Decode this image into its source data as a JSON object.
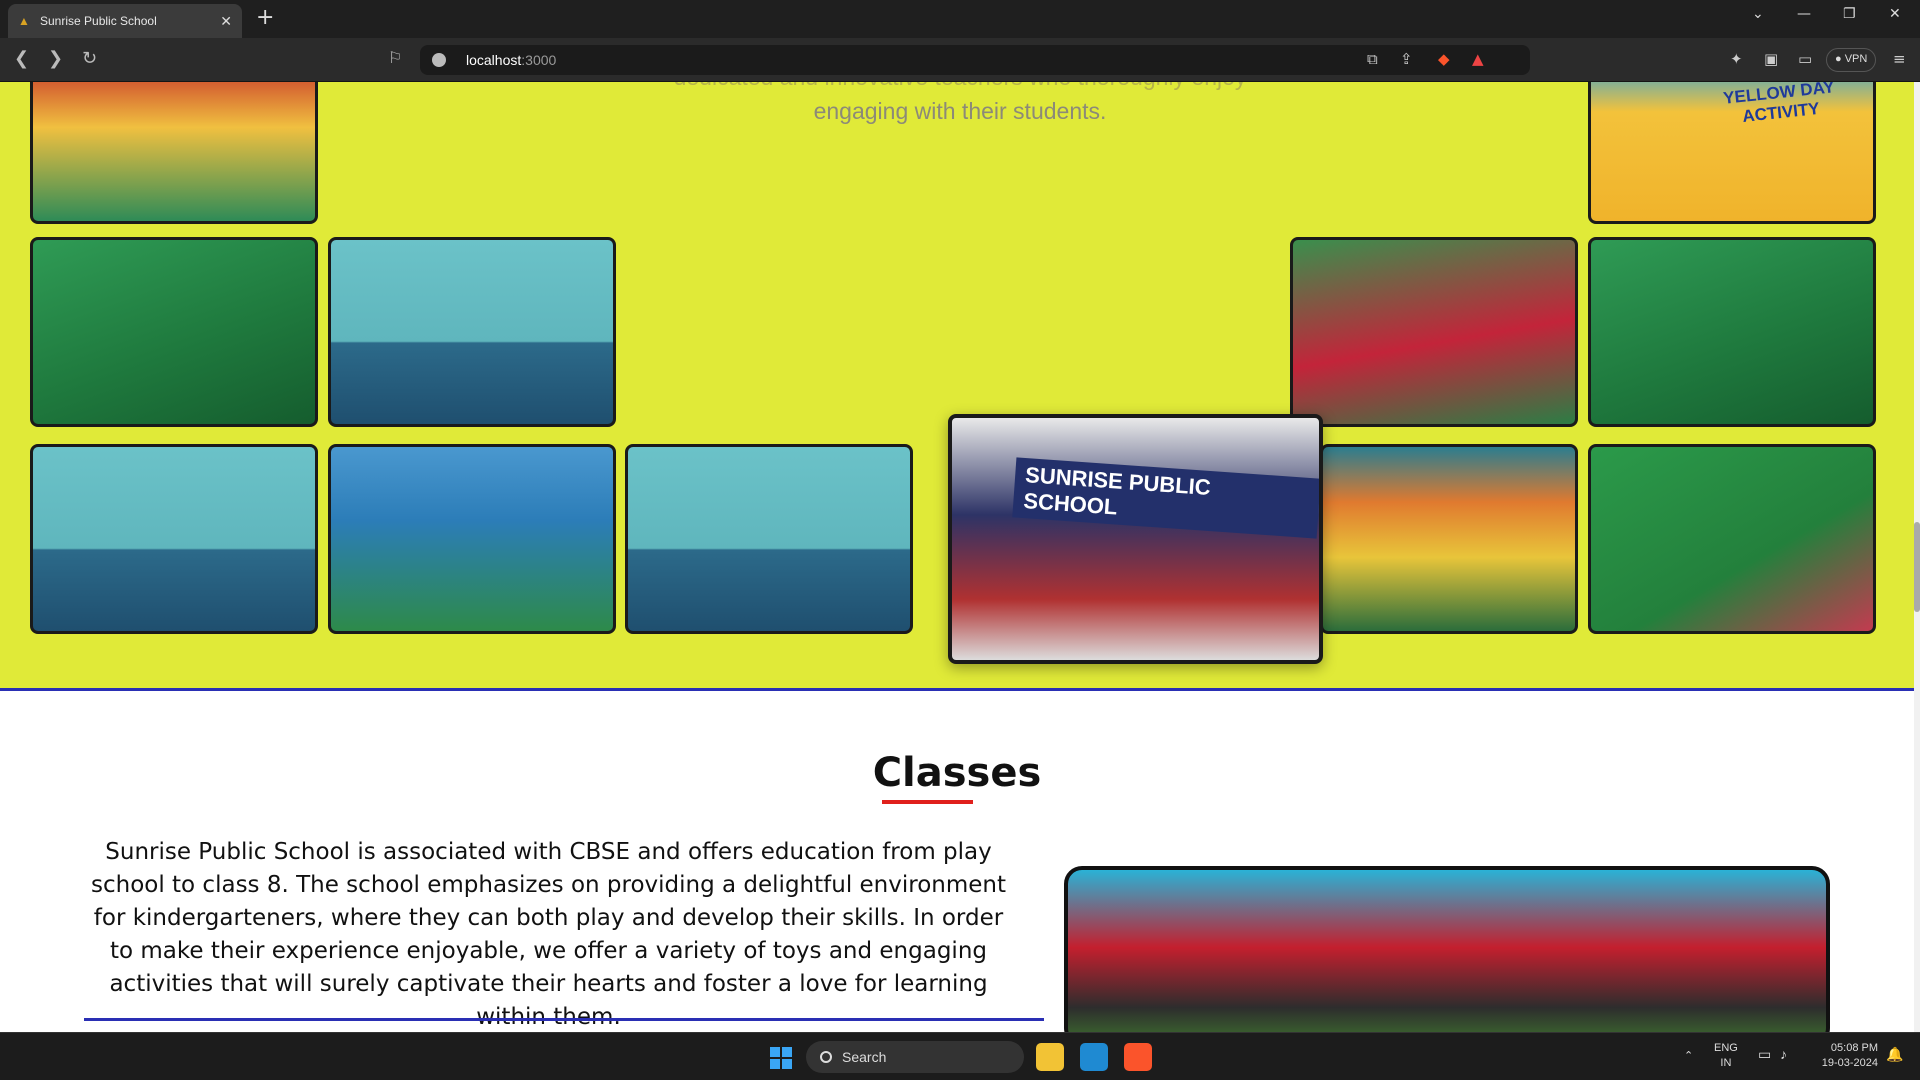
{
  "browser": {
    "tab_title": "Sunrise Public School",
    "tab_close": "✕",
    "new_tab": "+",
    "url_host": "localhost",
    "url_port": ":3000",
    "vpn_label": "VPN",
    "win_minimize": "—",
    "win_restore": "❐",
    "win_close": "✕",
    "tab_list": "⌄"
  },
  "gallery": {
    "intro_line1": "dedicated and innovative teachers who thoroughly enjoy",
    "intro_line2": "engaging with their students.",
    "banner_text": "SUNRISE PUBLIC SCHOOL",
    "yellow_day_text": "YELLOW DAY ACTIVITY"
  },
  "classes": {
    "title": "Classes",
    "description": "Sunrise Public School is associated with CBSE and offers education from play school to class 8. The school emphasizes on providing a delightful environment for kindergarteners, where they can both play and develop their skills. In order to make their experience enjoyable, we offer a variety of toys and engaging activities that will surely captivate their hearts and foster a love for learning within them."
  },
  "taskbar": {
    "search_label": "Search",
    "lang_top": "ENG",
    "lang_bottom": "IN",
    "time": "05:08 PM",
    "date": "19-03-2024"
  },
  "colors": {
    "gallery_bg": "#e0ea38",
    "accent_underline": "#e0201c",
    "rule_blue": "#2a2fb4"
  }
}
